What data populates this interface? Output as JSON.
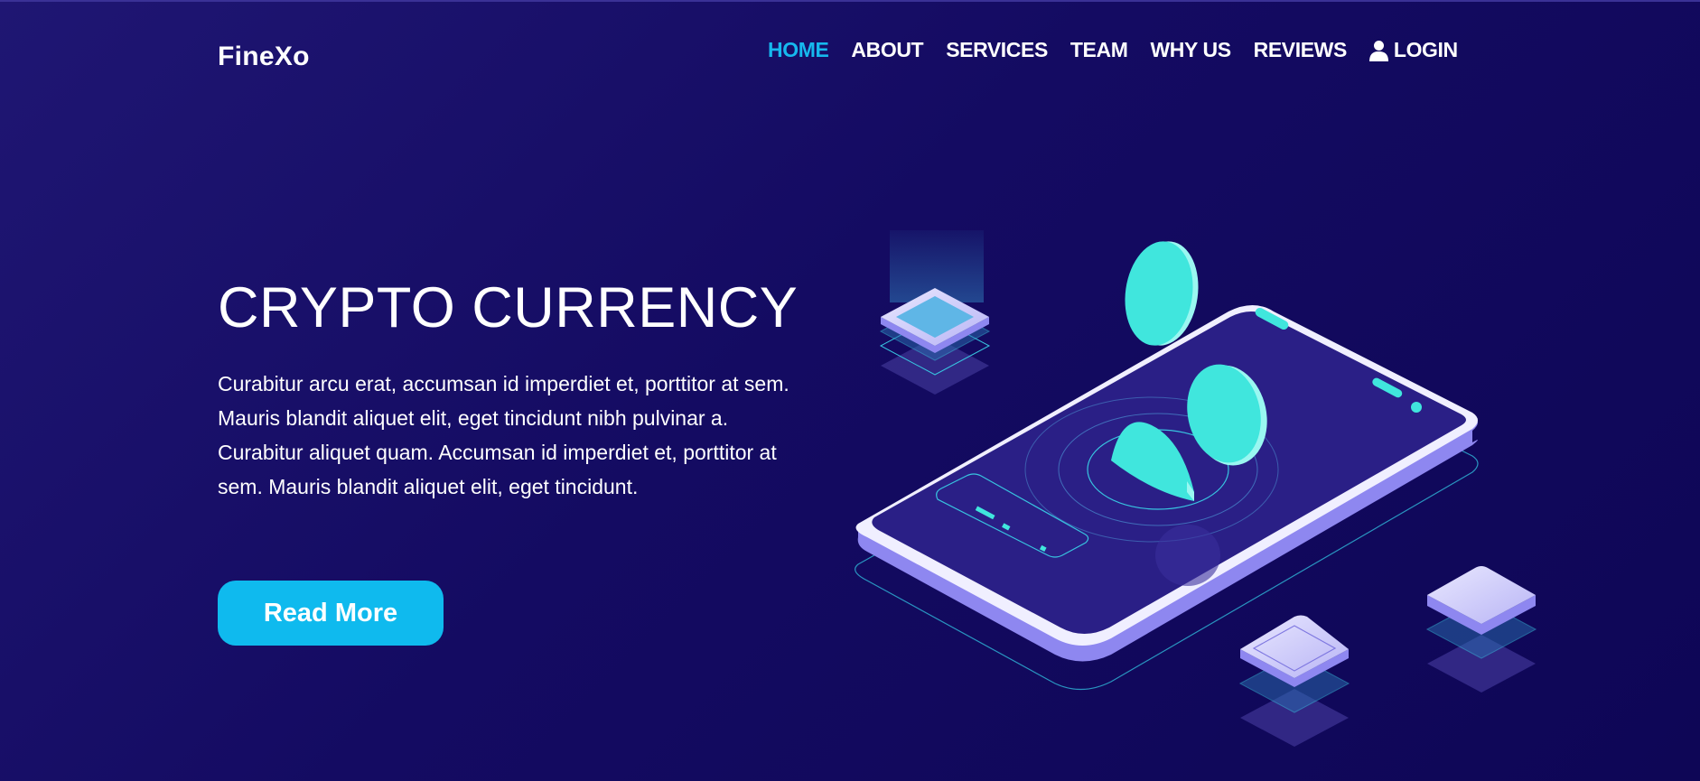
{
  "brand": {
    "name": "FineXo"
  },
  "nav": {
    "items": [
      {
        "label": "HOME",
        "active": true
      },
      {
        "label": "ABOUT",
        "active": false
      },
      {
        "label": "SERVICES",
        "active": false
      },
      {
        "label": "TEAM",
        "active": false
      },
      {
        "label": "WHY US",
        "active": false
      },
      {
        "label": "REVIEWS",
        "active": false
      }
    ],
    "login": {
      "label": "LOGIN",
      "icon": "user-icon"
    }
  },
  "hero": {
    "title": "CRYPTO CURRENCY",
    "text": "Curabitur arcu erat, accumsan id imperdiet et, porttitor at sem. Mauris blandit aliquet elit, eget tincidunt nibh pulvinar a. Curabitur aliquet quam. Accumsan id imperdiet et, porttitor at sem. Mauris blandit aliquet elit, eget tincidunt.",
    "button_label": "Read More"
  },
  "colors": {
    "background": "#140b62",
    "accent": "#0fbaee",
    "nav_active": "#16b8ee",
    "coin": "#40e6dd",
    "phone_screen": "#2a1f86",
    "phone_edge": "#8e87f0"
  }
}
